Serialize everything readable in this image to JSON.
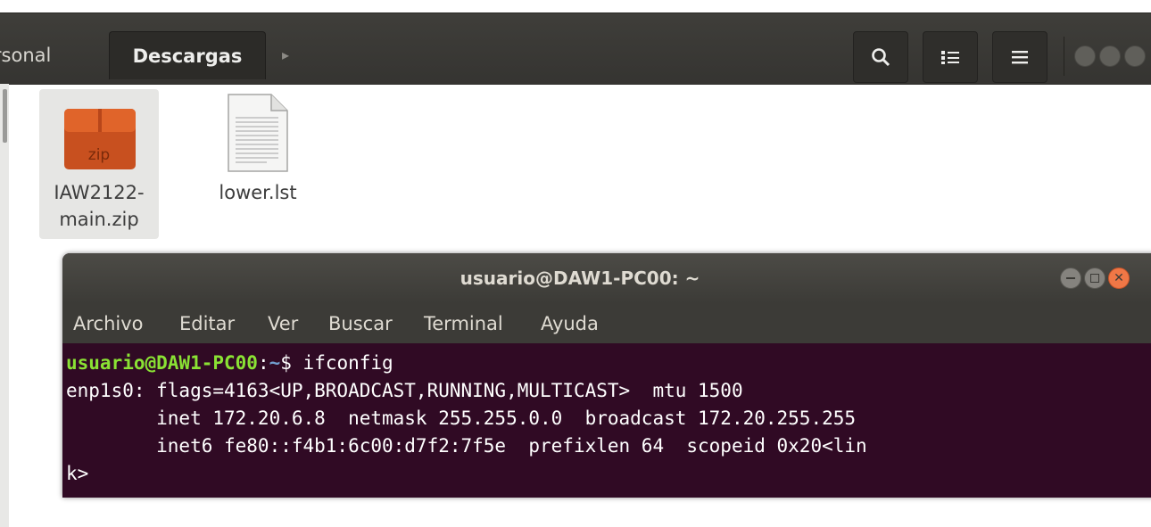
{
  "file_manager": {
    "breadcrumbs": [
      "ersonal",
      "Descargas"
    ],
    "next_arrow": "▸",
    "files": [
      {
        "name_line1": "IAW2122-",
        "name_line2": "main.zip",
        "icon_text": "zip",
        "icon": "zip-archive-icon"
      },
      {
        "name": "lower.lst",
        "icon": "text-document-icon"
      }
    ],
    "toolbar_icons": [
      "search-icon",
      "view-toggle-icon",
      "hamburger-menu-icon"
    ]
  },
  "terminal": {
    "title": "usuario@DAW1-PC00: ~",
    "menu": [
      "Archivo",
      "Editar",
      "Ver",
      "Buscar",
      "Terminal",
      "Ayuda"
    ],
    "prompt_user": "usuario@DAW1-PC00",
    "prompt_sep": ":",
    "prompt_path": "~",
    "prompt_symbol": "$ ",
    "command": "ifconfig",
    "output": [
      "enp1s0: flags=4163<UP,BROADCAST,RUNNING,MULTICAST>  mtu 1500",
      "        inet 172.20.6.8  netmask 255.255.0.0  broadcast 172.20.255.255",
      "        inet6 fe80::f4b1:6c00:d7f2:7f5e  prefixlen 64  scopeid 0x20<lin",
      "k>"
    ]
  },
  "colors": {
    "terminal_bg": "#300a24",
    "prompt_user": "#8ae234",
    "prompt_path": "#729fcf",
    "close_button": "#f07746",
    "header_bg": "#3f3e3a"
  }
}
